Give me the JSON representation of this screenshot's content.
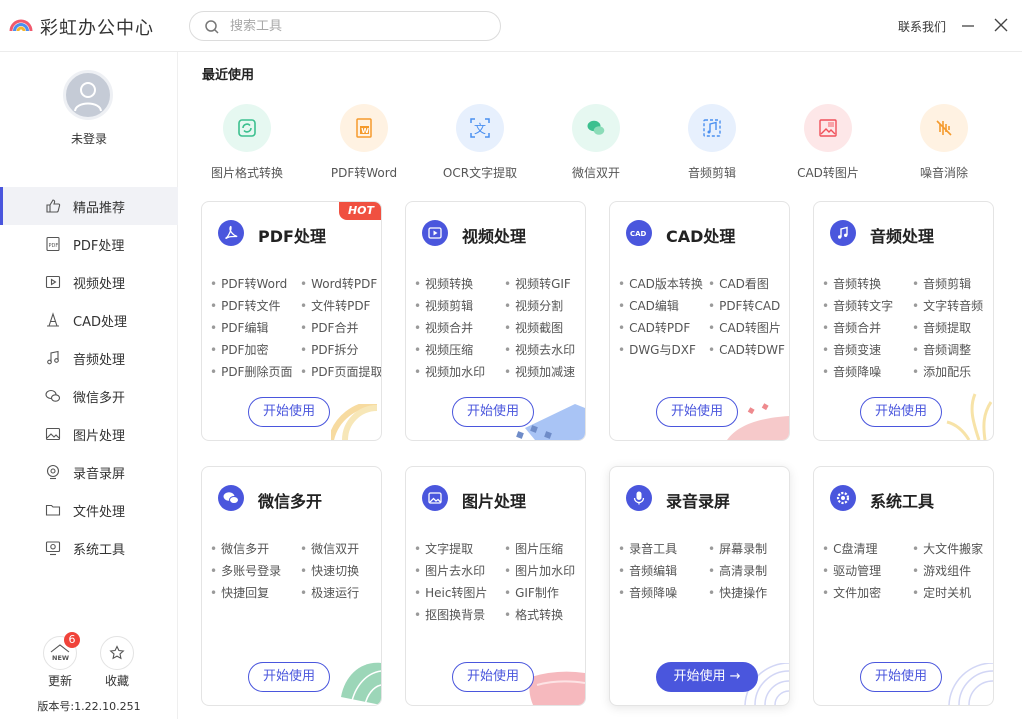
{
  "app": {
    "title": "彩虹办公中心"
  },
  "search": {
    "placeholder": "搜索工具"
  },
  "header": {
    "contact": "联系我们"
  },
  "user": {
    "login_label": "未登录"
  },
  "sidebar": {
    "items": [
      {
        "label": "精品推荐",
        "icon": "thumbs-up-icon"
      },
      {
        "label": "PDF处理",
        "icon": "pdf-icon"
      },
      {
        "label": "视频处理",
        "icon": "video-icon"
      },
      {
        "label": "CAD处理",
        "icon": "cad-icon"
      },
      {
        "label": "音频处理",
        "icon": "music-icon"
      },
      {
        "label": "微信多开",
        "icon": "wechat-icon"
      },
      {
        "label": "图片处理",
        "icon": "image-icon"
      },
      {
        "label": "录音录屏",
        "icon": "record-icon"
      },
      {
        "label": "文件处理",
        "icon": "folder-icon"
      },
      {
        "label": "系统工具",
        "icon": "system-icon"
      }
    ],
    "update_label": "更新",
    "update_badge": "6",
    "update_icon_text": "NEW",
    "favorite_label": "收藏",
    "version": "版本号:1.22.10.251"
  },
  "recent": {
    "title": "最近使用",
    "items": [
      {
        "label": "图片格式转换",
        "icon": "image-convert-icon",
        "color": "#3cc08f",
        "bg": "#e6f8f1"
      },
      {
        "label": "PDF转Word",
        "icon": "word-icon",
        "color": "#f59a2c",
        "bg": "#fff2e2"
      },
      {
        "label": "OCR文字提取",
        "icon": "ocr-text-icon",
        "color": "#4a8ff0",
        "bg": "#e7f0fd"
      },
      {
        "label": "微信双开",
        "icon": "wechat-icon",
        "color": "#3cc08f",
        "bg": "#e6f8f1"
      },
      {
        "label": "音频剪辑",
        "icon": "audio-cut-icon",
        "color": "#4a8ff0",
        "bg": "#e7f0fd"
      },
      {
        "label": "CAD转图片",
        "icon": "cad-image-icon",
        "color": "#f0505a",
        "bg": "#fde7e8"
      },
      {
        "label": "噪音消除",
        "icon": "noise-icon",
        "color": "#f59a2c",
        "bg": "#fff2e2"
      }
    ]
  },
  "cards": [
    {
      "title": "PDF处理",
      "icon": "pdf-icon",
      "hot": "HOT",
      "button": "开始使用",
      "left": [
        "PDF转Word",
        "PDF转文件",
        "PDF编辑",
        "PDF加密",
        "PDF删除页面"
      ],
      "right": [
        "Word转PDF",
        "文件转PDF",
        "PDF合并",
        "PDF拆分",
        "PDF页面提取"
      ]
    },
    {
      "title": "视频处理",
      "icon": "video-icon",
      "button": "开始使用",
      "left": [
        "视频转换",
        "视频剪辑",
        "视频合并",
        "视频压缩",
        "视频加水印"
      ],
      "right": [
        "视频转GIF",
        "视频分割",
        "视频截图",
        "视频去水印",
        "视频加减速"
      ]
    },
    {
      "title": "CAD处理",
      "icon": "cad-icon",
      "icon_text": "CAD",
      "button": "开始使用",
      "left": [
        "CAD版本转换",
        "CAD编辑",
        "CAD转PDF",
        "DWG与DXF"
      ],
      "right": [
        "CAD看图",
        "PDF转CAD",
        "CAD转图片",
        "CAD转DWF"
      ]
    },
    {
      "title": "音频处理",
      "icon": "music-icon",
      "button": "开始使用",
      "left": [
        "音频转换",
        "音频转文字",
        "音频合并",
        "音频变速",
        "音频降噪"
      ],
      "right": [
        "音频剪辑",
        "文字转音频",
        "音频提取",
        "音频调整",
        "添加配乐"
      ]
    },
    {
      "title": "微信多开",
      "icon": "wechat-icon",
      "button": "开始使用",
      "left": [
        "微信多开",
        "多账号登录",
        "快捷回复"
      ],
      "right": [
        "微信双开",
        "快速切换",
        "极速运行"
      ]
    },
    {
      "title": "图片处理",
      "icon": "image-icon",
      "button": "开始使用",
      "left": [
        "文字提取",
        "图片去水印",
        "Heic转图片",
        "抠图换背景"
      ],
      "right": [
        "图片压缩",
        "图片加水印",
        "GIF制作",
        "格式转换"
      ]
    },
    {
      "title": "录音录屏",
      "icon": "mic-icon",
      "button": "开始使用",
      "button_arrow": "→",
      "left": [
        "录音工具",
        "音频编辑",
        "音频降噪"
      ],
      "right": [
        "屏幕录制",
        "高清录制",
        "快捷操作"
      ]
    },
    {
      "title": "系统工具",
      "icon": "gear-icon",
      "button": "开始使用",
      "left": [
        "C盘清理",
        "驱动管理",
        "文件加密"
      ],
      "right": [
        "大文件搬家",
        "游戏组件",
        "定时关机"
      ]
    }
  ],
  "colors": {
    "accent": "#4a56dd",
    "hot": "#f05040"
  }
}
